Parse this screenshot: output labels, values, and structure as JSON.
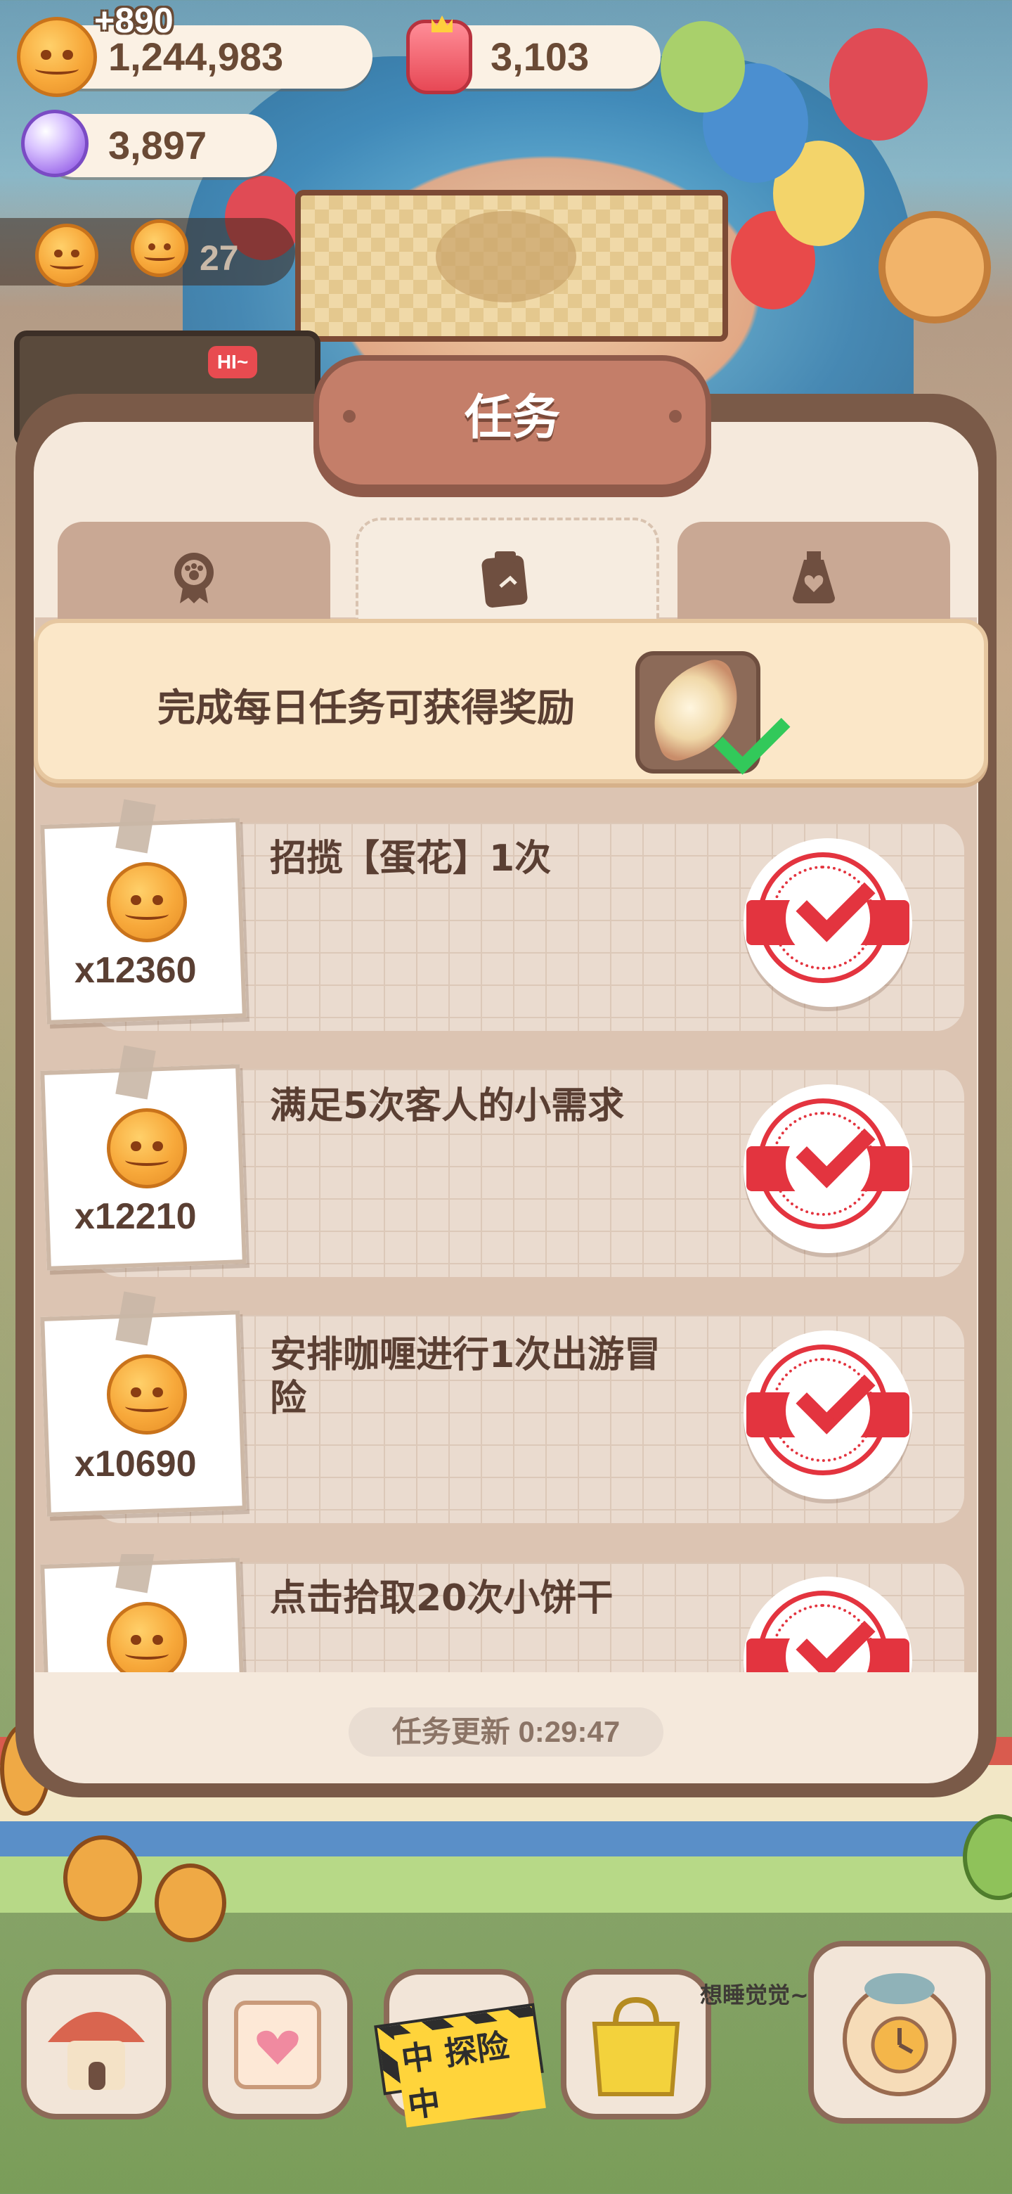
{
  "hud": {
    "plus_float": "+890",
    "coins": "1,244,983",
    "hearts": "3,103",
    "gems": "3,897",
    "side_count": "27"
  },
  "background": {
    "hi_sign": "HI~",
    "explore_label": "中 探险中",
    "sleep_text": "想睡觉觉~"
  },
  "dialog": {
    "title": "任务",
    "tabs": [
      {
        "icon": "paw-medal-icon",
        "active": false
      },
      {
        "icon": "clipboard-icon",
        "active": true
      },
      {
        "icon": "bottle-heart-icon",
        "active": false
      }
    ],
    "banner_text": "完成每日任务可获得奖励",
    "tasks": [
      {
        "title": "招揽【蛋花】1次",
        "reward": "x12360",
        "completed": true
      },
      {
        "title": "满足5次客人的小需求",
        "reward": "x12210",
        "completed": true
      },
      {
        "title": "安排咖喱进行1次出游冒险",
        "reward": "x10690",
        "completed": true
      },
      {
        "title": "点击拾取20次小饼干",
        "reward": "",
        "completed": true
      }
    ],
    "refresh_text": "任务更新 0:29:47"
  },
  "colors": {
    "accent_red": "#e3343f",
    "brown": "#5a3f33",
    "check_green": "#32c95a"
  }
}
